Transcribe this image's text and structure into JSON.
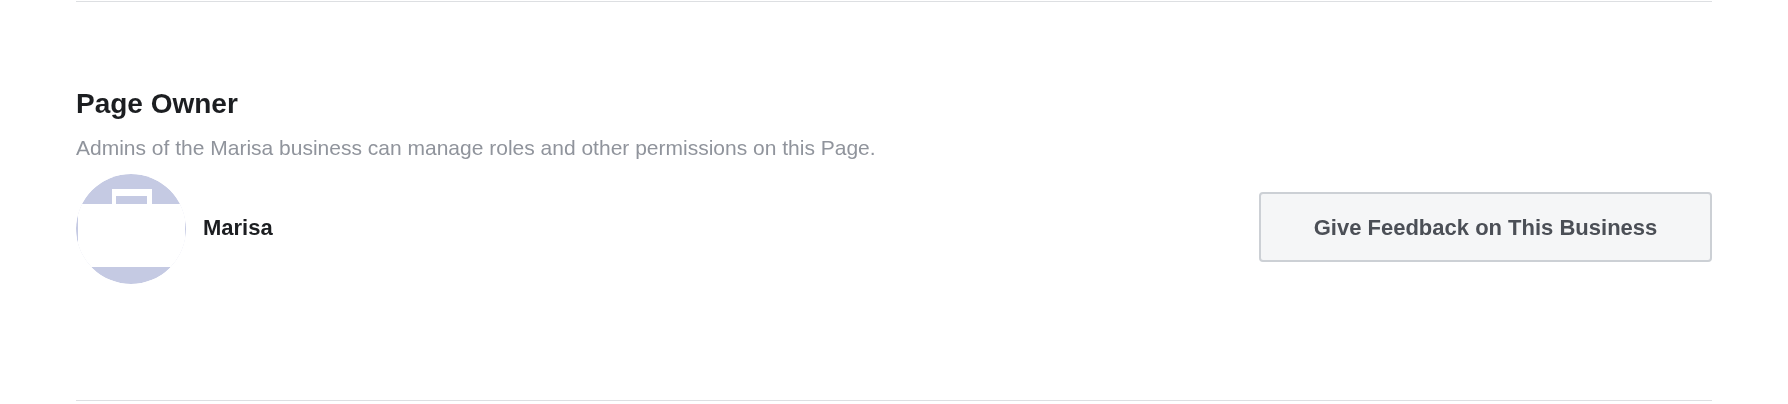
{
  "section": {
    "title": "Page Owner",
    "description": "Admins of the Marisa business can manage roles and other permissions on this Page.",
    "owner": {
      "name": "Marisa"
    },
    "button": "Give Feedback on This Business"
  }
}
